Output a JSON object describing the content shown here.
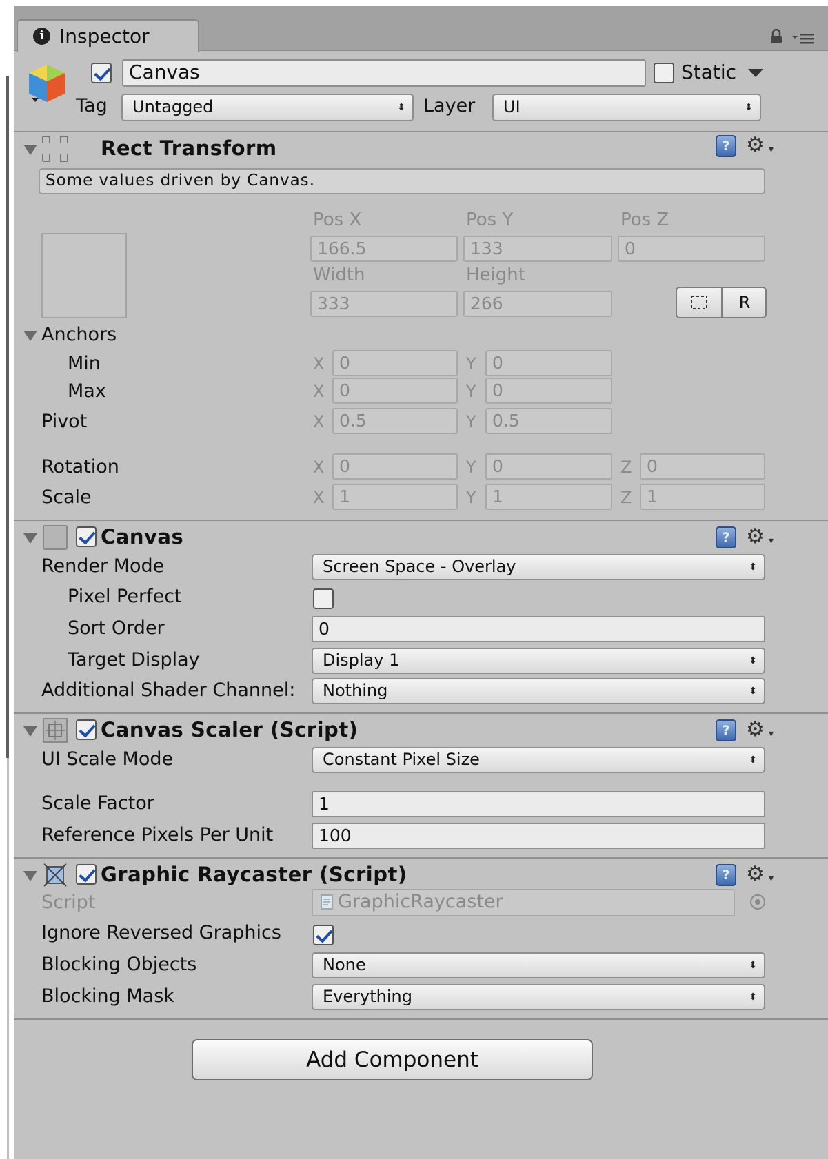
{
  "colors": {
    "panel": "#c2c2c2",
    "tabbar": "#a2a2a2",
    "field": "#ebebeb",
    "checkmark": "#1f4fa8",
    "help_icon": "#3f6ab0"
  },
  "tab": {
    "label": "Inspector",
    "icon": "info-icon"
  },
  "header": {
    "active": true,
    "name": "Canvas",
    "static_label": "Static",
    "static_checked": false,
    "tag_label": "Tag",
    "tag_value": "Untagged",
    "layer_label": "Layer",
    "layer_value": "UI"
  },
  "rect_transform": {
    "title": "Rect Transform",
    "info": "Some values driven by Canvas.",
    "pos_x_label": "Pos X",
    "pos_y_label": "Pos Y",
    "pos_z_label": "Pos Z",
    "pos_x": "166.5",
    "pos_y": "133",
    "pos_z": "0",
    "width_label": "Width",
    "height_label": "Height",
    "width": "333",
    "height": "266",
    "raw_button": "R",
    "anchors_label": "Anchors",
    "min_label": "Min",
    "max_label": "Max",
    "min_x": "0",
    "min_y": "0",
    "max_x": "0",
    "max_y": "0",
    "pivot_label": "Pivot",
    "pivot_x": "0.5",
    "pivot_y": "0.5",
    "rotation_label": "Rotation",
    "rot_x": "0",
    "rot_y": "0",
    "rot_z": "0",
    "scale_label": "Scale",
    "scale_x": "1",
    "scale_y": "1",
    "scale_z": "1",
    "axis_x": "X",
    "axis_y": "Y",
    "axis_z": "Z"
  },
  "canvas": {
    "title": "Canvas",
    "enabled": true,
    "render_mode_label": "Render Mode",
    "render_mode": "Screen Space - Overlay",
    "pixel_perfect_label": "Pixel Perfect",
    "pixel_perfect": false,
    "sort_order_label": "Sort Order",
    "sort_order": "0",
    "target_display_label": "Target Display",
    "target_display": "Display 1",
    "shader_channels_label": "Additional Shader Channel:",
    "shader_channels": "Nothing"
  },
  "canvas_scaler": {
    "title": "Canvas Scaler (Script)",
    "enabled": true,
    "scale_mode_label": "UI Scale Mode",
    "scale_mode": "Constant Pixel Size",
    "scale_factor_label": "Scale Factor",
    "scale_factor": "1",
    "ref_ppu_label": "Reference Pixels Per Unit",
    "ref_ppu": "100"
  },
  "graphic_raycaster": {
    "title": "Graphic Raycaster (Script)",
    "enabled": true,
    "script_label": "Script",
    "script_value": "GraphicRaycaster",
    "ignore_reversed_label": "Ignore Reversed Graphics",
    "ignore_reversed": true,
    "blocking_objects_label": "Blocking Objects",
    "blocking_objects": "None",
    "blocking_mask_label": "Blocking Mask",
    "blocking_mask": "Everything"
  },
  "footer": {
    "add_component": "Add Component"
  },
  "icons": {
    "dropdown_arrow": "⬍",
    "help": "?",
    "gear": "⚙",
    "lock": "lock-icon",
    "menu": "context-menu-icon"
  }
}
